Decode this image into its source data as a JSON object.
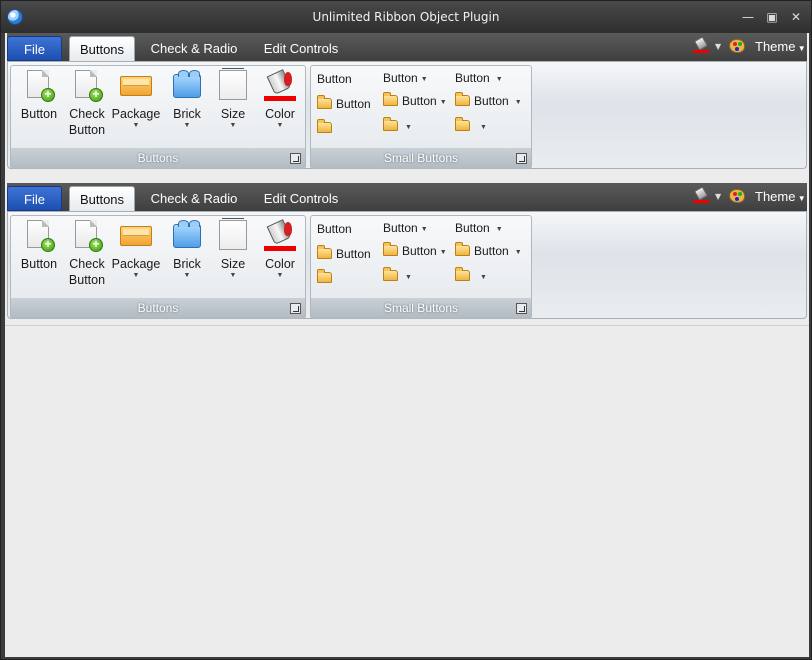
{
  "window": {
    "title": "Unlimited Ribbon Object Plugin",
    "controls": [
      "minimize-icon",
      "maximize-icon",
      "close-icon"
    ]
  },
  "ribbons": [
    {
      "tabs": [
        "File",
        "Buttons",
        "Check & Radio",
        "Edit Controls"
      ],
      "active_tab": "Buttons",
      "theme_label": "Theme",
      "groups": {
        "buttons": {
          "caption": "Buttons",
          "items": [
            {
              "label": "Button",
              "label2": "",
              "icon": "new-document-icon",
              "dropdown": false
            },
            {
              "label": "Check",
              "label2": "Button",
              "icon": "new-document-icon",
              "dropdown": false
            },
            {
              "label": "Package",
              "label2": "",
              "icon": "package-icon",
              "dropdown": true
            },
            {
              "label": "Brick",
              "label2": "",
              "icon": "brick-icon",
              "dropdown": true
            },
            {
              "label": "Size",
              "label2": "",
              "icon": "size-icon",
              "dropdown": true
            },
            {
              "label": "Color",
              "label2": "",
              "icon": "paint-bucket-icon",
              "dropdown": true
            }
          ]
        },
        "small_buttons": {
          "caption": "Small Buttons",
          "col1": [
            "Button",
            "Button",
            ""
          ],
          "col2": [
            "Button",
            "Button",
            ""
          ],
          "col3": [
            "Button",
            "Button",
            ""
          ]
        }
      }
    },
    {
      "tabs": [
        "File",
        "Buttons",
        "Check & Radio",
        "Edit Controls"
      ],
      "active_tab": "Buttons",
      "theme_label": "Theme",
      "groups": {
        "buttons": {
          "caption": "Buttons",
          "items": [
            {
              "label": "Button",
              "label2": "",
              "icon": "new-document-icon",
              "dropdown": false
            },
            {
              "label": "Check",
              "label2": "Button",
              "icon": "new-document-icon",
              "dropdown": false
            },
            {
              "label": "Package",
              "label2": "",
              "icon": "package-icon",
              "dropdown": true
            },
            {
              "label": "Brick",
              "label2": "",
              "icon": "brick-icon",
              "dropdown": true
            },
            {
              "label": "Size",
              "label2": "",
              "icon": "size-icon",
              "dropdown": true
            },
            {
              "label": "Color",
              "label2": "",
              "icon": "paint-bucket-icon",
              "dropdown": true
            }
          ]
        },
        "small_buttons": {
          "caption": "Small Buttons",
          "col1": [
            "Button",
            "Button",
            ""
          ],
          "col2": [
            "Button",
            "Button",
            ""
          ],
          "col3": [
            "Button",
            "Button",
            ""
          ]
        }
      }
    }
  ],
  "colors": {
    "file_tab": "#1c4fb0",
    "color_bar": "#e00000",
    "tab_strip": "#3f3f3f"
  }
}
